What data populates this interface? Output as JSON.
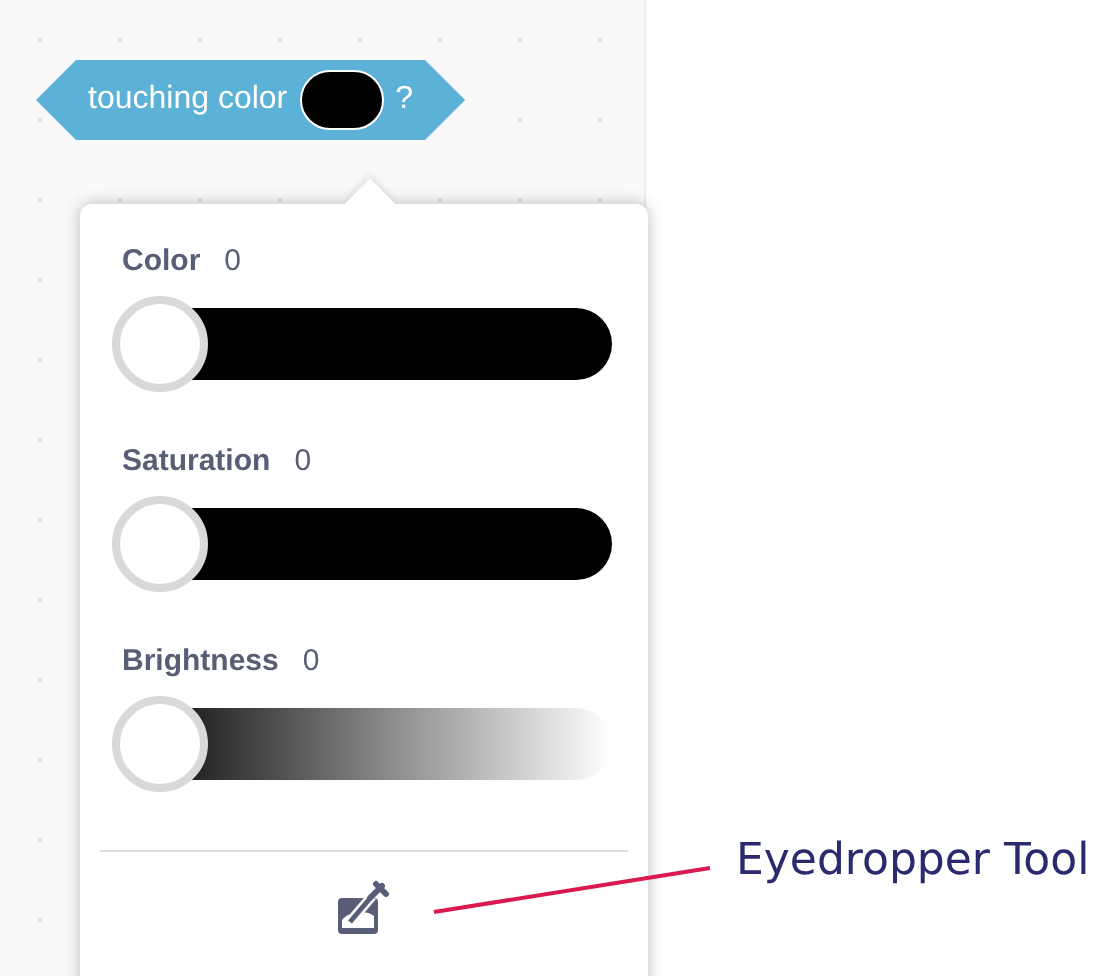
{
  "block": {
    "label": "touching color",
    "suffix": "?"
  },
  "sliders": [
    {
      "label": "Color",
      "reading": "0",
      "level": 0,
      "kind": "solid"
    },
    {
      "label": "Saturation",
      "reading": "0",
      "level": 0,
      "kind": "solid"
    },
    {
      "label": "Brightness",
      "reading": "0",
      "level": 0,
      "kind": "gradient"
    }
  ],
  "annotation": {
    "label": "Eyedropper Tool"
  }
}
